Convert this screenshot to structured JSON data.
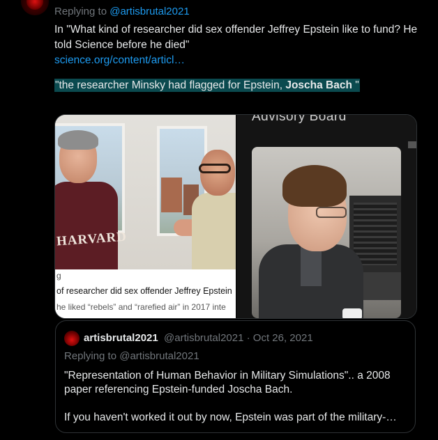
{
  "tweet": {
    "replying_prefix": "Replying to ",
    "replying_handle": "@artisbrutal2021",
    "text": "In \"What kind of researcher did sex offender Jeffrey Epstein like to fund? He told Science before he died\"",
    "link": "science.org/content/articl…",
    "highlight_pre": "\"the researcher Minsky had flagged for Epstein, ",
    "highlight_bold": "Joscha Bach",
    "highlight_post": " \""
  },
  "media": {
    "left_photo_text": "HARVARD",
    "caption_site": "g",
    "caption_title": "of researcher did sex offender Jeffrey Epstein",
    "caption_sub": "he liked “rebels” and “rarefied air” in 2017 inte",
    "right_header": "Advisory Board"
  },
  "quote_tweet": {
    "name": "artisbrutal2021",
    "meta": "@artisbrutal2021 · Oct 26, 2021",
    "replying": "Replying to @artisbrutal2021",
    "para1": "\"Representation of Human Behavior in Military Simulations\".. a 2008 paper referencing Epstein-funded Joscha Bach.",
    "para2": "If you haven't worked it out by now, Epstein was part of the military-…"
  }
}
